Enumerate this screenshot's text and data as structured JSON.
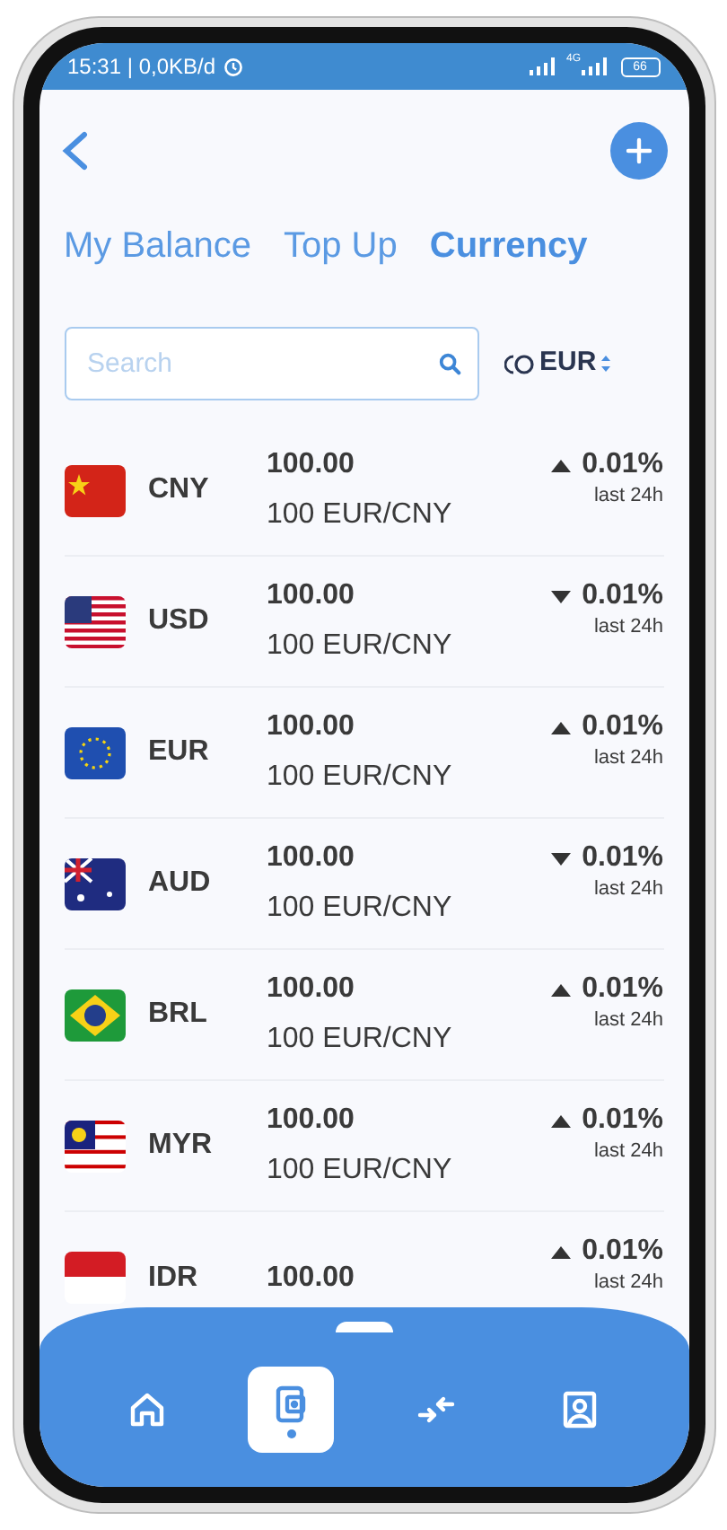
{
  "status_bar": {
    "time": "15:31 | 0,0KB/d",
    "network": "4G",
    "battery": "66"
  },
  "tabs": [
    {
      "label": "My Balance",
      "selected": false
    },
    {
      "label": "Top Up",
      "selected": false
    },
    {
      "label": "Currency",
      "selected": true
    }
  ],
  "search": {
    "placeholder": "Search"
  },
  "base_currency": "EUR",
  "currencies": [
    {
      "code": "CNY",
      "kind": "cn",
      "price": "100.00",
      "pair": "100 EUR/CNY",
      "rising": true,
      "change": "0.01%",
      "period": "last 24h"
    },
    {
      "code": "USD",
      "kind": "us",
      "price": "100.00",
      "pair": "100 EUR/CNY",
      "rising": false,
      "change": "0.01%",
      "period": "last 24h"
    },
    {
      "code": "EUR",
      "kind": "eu",
      "price": "100.00",
      "pair": "100 EUR/CNY",
      "rising": true,
      "change": "0.01%",
      "period": "last 24h"
    },
    {
      "code": "AUD",
      "kind": "au",
      "price": "100.00",
      "pair": "100 EUR/CNY",
      "rising": false,
      "change": "0.01%",
      "period": "last 24h"
    },
    {
      "code": "BRL",
      "kind": "br",
      "price": "100.00",
      "pair": "100 EUR/CNY",
      "rising": true,
      "change": "0.01%",
      "period": "last 24h"
    },
    {
      "code": "MYR",
      "kind": "my",
      "price": "100.00",
      "pair": "100 EUR/CNY",
      "rising": true,
      "change": "0.01%",
      "period": "last 24h"
    },
    {
      "code": "IDR",
      "kind": "id",
      "price": "100.00",
      "rising": true,
      "change": "0.01%",
      "period": "last 24h"
    }
  ],
  "nav": [
    {
      "kind": "home",
      "selected": false
    },
    {
      "kind": "wallet",
      "selected": true
    },
    {
      "kind": "exchange",
      "selected": false
    },
    {
      "kind": "profile",
      "selected": false
    }
  ]
}
